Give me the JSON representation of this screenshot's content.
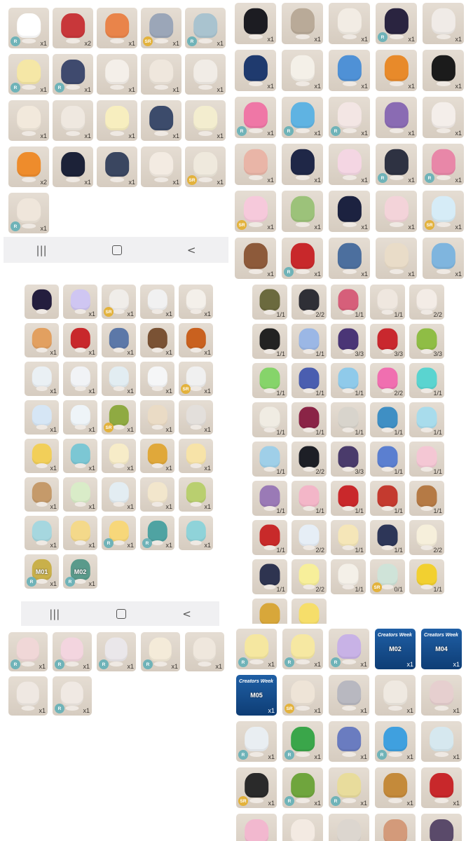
{
  "navbar": {
    "recent_icon": "|||",
    "back_icon": "<"
  },
  "panel_a": [
    {
      "n": "x1",
      "r": "R",
      "c": "#ffffff"
    },
    {
      "n": "x2",
      "r": "",
      "c": "#c8373a"
    },
    {
      "n": "x1",
      "r": "",
      "c": "#e9844a"
    },
    {
      "n": "x1",
      "r": "SR",
      "c": "#9ba6b8"
    },
    {
      "n": "x1",
      "r": "R",
      "c": "#a9c3cf"
    },
    {
      "n": "x1",
      "r": "R",
      "c": "#f5e7a6"
    },
    {
      "n": "x1",
      "r": "R",
      "c": "#3f4a6e"
    },
    {
      "n": "x1",
      "r": "",
      "c": "#f4efe9"
    },
    {
      "n": "x1",
      "r": "",
      "c": "#efe7dd"
    },
    {
      "n": "x1",
      "r": "",
      "c": "#f1ece6"
    },
    {
      "n": "x1",
      "r": "",
      "c": "#f2e9dc"
    },
    {
      "n": "x1",
      "r": "",
      "c": "#efe8e0"
    },
    {
      "n": "x1",
      "r": "",
      "c": "#f7eebf"
    },
    {
      "n": "x1",
      "r": "",
      "c": "#3c4b6b"
    },
    {
      "n": "x1",
      "r": "",
      "c": "#f3edcf"
    },
    {
      "n": "x2",
      "r": "",
      "c": "#ee8c2c"
    },
    {
      "n": "x1",
      "r": "",
      "c": "#1c2238"
    },
    {
      "n": "x1",
      "r": "",
      "c": "#3a4660"
    },
    {
      "n": "x1",
      "r": "",
      "c": "#f3ebe2"
    },
    {
      "n": "x1",
      "r": "SR",
      "c": "#efe9dd"
    },
    {
      "n": "x1",
      "r": "R",
      "c": "#efe6db"
    }
  ],
  "panel_b": [
    {
      "n": "x1",
      "r": "",
      "c": "#1c1c22"
    },
    {
      "n": "x1",
      "r": "",
      "c": "#b9aa98"
    },
    {
      "n": "x1",
      "r": "",
      "c": "#f2ece4"
    },
    {
      "n": "x1",
      "r": "R",
      "c": "#2a2440"
    },
    {
      "n": "x1",
      "r": "",
      "c": "#f0ebe7"
    },
    {
      "n": "x1",
      "r": "",
      "c": "#1f3a6e"
    },
    {
      "n": "x1",
      "r": "",
      "c": "#f4f0e8"
    },
    {
      "n": "x1",
      "r": "",
      "c": "#4f91d6"
    },
    {
      "n": "x1",
      "r": "",
      "c": "#e88a2a"
    },
    {
      "n": "x1",
      "r": "",
      "c": "#1b1b1b"
    },
    {
      "n": "x1",
      "r": "R",
      "c": "#ef77a6"
    },
    {
      "n": "x1",
      "r": "R",
      "c": "#5fb3e2"
    },
    {
      "n": "x1",
      "r": "R",
      "c": "#f3e6e4"
    },
    {
      "n": "x1",
      "r": "",
      "c": "#8a6bb3"
    },
    {
      "n": "x1",
      "r": "",
      "c": "#f4eeea"
    },
    {
      "n": "x1",
      "r": "",
      "c": "#e9b5a7"
    },
    {
      "n": "x1",
      "r": "",
      "c": "#1f2747"
    },
    {
      "n": "x1",
      "r": "",
      "c": "#f4d6e3"
    },
    {
      "n": "x1",
      "r": "R",
      "c": "#2e3242"
    },
    {
      "n": "x1",
      "r": "R",
      "c": "#e887a8"
    },
    {
      "n": "x1",
      "r": "SR",
      "c": "#f6c9db"
    },
    {
      "n": "x1",
      "r": "",
      "c": "#9cc27a"
    },
    {
      "n": "x1",
      "r": "",
      "c": "#1c2240"
    },
    {
      "n": "x1",
      "r": "",
      "c": "#f3d3d9"
    },
    {
      "n": "x1",
      "r": "SR",
      "c": "#d6ecf7"
    },
    {
      "n": "x1",
      "r": "",
      "c": "#8d5a3a"
    },
    {
      "n": "x1",
      "r": "R",
      "c": "#c8282b"
    },
    {
      "n": "x1",
      "r": "",
      "c": "#4c6f9e"
    },
    {
      "n": "x1",
      "r": "",
      "c": "#e9dcc8"
    },
    {
      "n": "x1",
      "r": "",
      "c": "#7fb5de"
    }
  ],
  "panel_c": [
    {
      "n": "",
      "r": "",
      "c": "#241e3e"
    },
    {
      "n": "x1",
      "r": "",
      "c": "#cfc6f2"
    },
    {
      "n": "x1",
      "r": "SR",
      "c": "#f0ede9"
    },
    {
      "n": "x1",
      "r": "",
      "c": "#f1f1f1"
    },
    {
      "n": "x1",
      "r": "",
      "c": "#f4f0ea"
    },
    {
      "n": "x1",
      "r": "",
      "c": "#e2a060"
    },
    {
      "n": "x1",
      "r": "",
      "c": "#c8282b"
    },
    {
      "n": "x1",
      "r": "",
      "c": "#5c78a8"
    },
    {
      "n": "x1",
      "r": "",
      "c": "#7a5234"
    },
    {
      "n": "x1",
      "r": "",
      "c": "#c9611f"
    },
    {
      "n": "x1",
      "r": "",
      "c": "#eaf0f4"
    },
    {
      "n": "x1",
      "r": "",
      "c": "#f1f3f6"
    },
    {
      "n": "x1",
      "r": "",
      "c": "#e2edf2"
    },
    {
      "n": "x1",
      "r": "",
      "c": "#f5f6f7"
    },
    {
      "n": "x1",
      "r": "SR",
      "c": "#f0f0f0"
    },
    {
      "n": "x1",
      "r": "",
      "c": "#d6e6f5"
    },
    {
      "n": "x1",
      "r": "",
      "c": "#eef4f8"
    },
    {
      "n": "x1",
      "r": "SR",
      "c": "#8faa42"
    },
    {
      "n": "x1",
      "r": "",
      "c": "#eadbc5"
    },
    {
      "n": "x1",
      "r": "",
      "c": "#e3dfdb"
    },
    {
      "n": "x1",
      "r": "",
      "c": "#f2cf59"
    },
    {
      "n": "x1",
      "r": "",
      "c": "#7cc7d4"
    },
    {
      "n": "x1",
      "r": "",
      "c": "#f7ecc8"
    },
    {
      "n": "x1",
      "r": "",
      "c": "#e0a83a"
    },
    {
      "n": "x1",
      "r": "",
      "c": "#f7e3a8"
    },
    {
      "n": "x1",
      "r": "",
      "c": "#c59a6a"
    },
    {
      "n": "x1",
      "r": "",
      "c": "#d9ecc8"
    },
    {
      "n": "x1",
      "r": "",
      "c": "#e3edf2"
    },
    {
      "n": "x1",
      "r": "",
      "c": "#f2e6cc"
    },
    {
      "n": "x1",
      "r": "",
      "c": "#b9cf6f"
    },
    {
      "n": "x1",
      "r": "",
      "c": "#a6d7df"
    },
    {
      "n": "x1",
      "r": "",
      "c": "#f4d98a"
    },
    {
      "n": "x1",
      "r": "R",
      "c": "#f7d77a"
    },
    {
      "n": "x1",
      "r": "R",
      "c": "#4fa3a2"
    },
    {
      "n": "x1",
      "r": "",
      "c": "#8fd3d9"
    },
    {
      "n": "x1",
      "r": "R",
      "c": "#c9b04a",
      "label": "M01"
    },
    {
      "n": "x1",
      "r": "R",
      "c": "#5a9a8b",
      "label": "M02"
    }
  ],
  "panel_d": [
    {
      "n": "1/1",
      "r": "",
      "c": "#6b6a3e"
    },
    {
      "n": "2/2",
      "r": "",
      "c": "#2f2f36"
    },
    {
      "n": "1/1",
      "r": "",
      "c": "#d65f7a"
    },
    {
      "n": "1/1",
      "r": "",
      "c": "#efe7df"
    },
    {
      "n": "2/2",
      "r": "",
      "c": "#f3ece6"
    },
    {
      "n": "1/1",
      "r": "",
      "c": "#222222"
    },
    {
      "n": "1/1",
      "r": "",
      "c": "#9bb7e5"
    },
    {
      "n": "3/3",
      "r": "",
      "c": "#4a3576"
    },
    {
      "n": "3/3",
      "r": "",
      "c": "#c9282e"
    },
    {
      "n": "3/3",
      "r": "",
      "c": "#8fbd45"
    },
    {
      "n": "1/1",
      "r": "",
      "c": "#86d46a"
    },
    {
      "n": "1/1",
      "r": "",
      "c": "#4a5eb0"
    },
    {
      "n": "1/1",
      "r": "",
      "c": "#8fcaea"
    },
    {
      "n": "2/2",
      "r": "",
      "c": "#f06fb0"
    },
    {
      "n": "1/1",
      "r": "",
      "c": "#5ad4d0"
    },
    {
      "n": "1/1",
      "r": "",
      "c": "#f0ece3"
    },
    {
      "n": "1/1",
      "r": "",
      "c": "#8a2446"
    },
    {
      "n": "1/1",
      "r": "",
      "c": "#d8d4cc"
    },
    {
      "n": "1/1",
      "r": "",
      "c": "#3f8fc4"
    },
    {
      "n": "1/1",
      "r": "",
      "c": "#a8dcec"
    },
    {
      "n": "1/1",
      "r": "",
      "c": "#9fcfe8"
    },
    {
      "n": "2/2",
      "r": "",
      "c": "#1d1f26"
    },
    {
      "n": "3/3",
      "r": "",
      "c": "#4a3b6b"
    },
    {
      "n": "1/1",
      "r": "",
      "c": "#5b7fd0"
    },
    {
      "n": "1/1",
      "r": "",
      "c": "#f4c7d4"
    },
    {
      "n": "1/1",
      "r": "",
      "c": "#9a7ab6"
    },
    {
      "n": "1/1",
      "r": "",
      "c": "#f3b6c8"
    },
    {
      "n": "1/1",
      "r": "",
      "c": "#c9282b"
    },
    {
      "n": "1/1",
      "r": "",
      "c": "#c43a2f"
    },
    {
      "n": "1/1",
      "r": "",
      "c": "#b57a45"
    },
    {
      "n": "1/1",
      "r": "",
      "c": "#c82a2a"
    },
    {
      "n": "2/2",
      "r": "",
      "c": "#e6eef6"
    },
    {
      "n": "1/1",
      "r": "",
      "c": "#f5e6b8"
    },
    {
      "n": "1/1",
      "r": "",
      "c": "#2d3658"
    },
    {
      "n": "2/2",
      "r": "",
      "c": "#f6efdb"
    },
    {
      "n": "1/1",
      "r": "",
      "c": "#2e3450"
    },
    {
      "n": "2/2",
      "r": "",
      "c": "#f7ef9a"
    },
    {
      "n": "1/1",
      "r": "",
      "c": "#f4f0e8"
    },
    {
      "n": "0/1",
      "r": "SR",
      "c": "#cfe3d8"
    },
    {
      "n": "1/1",
      "r": "",
      "c": "#f2d030"
    },
    {
      "n": "",
      "r": "",
      "c": "#d8a73a"
    },
    {
      "n": "",
      "r": "",
      "c": "#f6de6a"
    }
  ],
  "panel_e": [
    {
      "n": "x1",
      "r": "R",
      "c": "#f0d7d7"
    },
    {
      "n": "x1",
      "r": "R",
      "c": "#f3d5df"
    },
    {
      "n": "x1",
      "r": "R",
      "c": "#eae7ea"
    },
    {
      "n": "x1",
      "r": "R",
      "c": "#f4ebd9"
    },
    {
      "n": "x1",
      "r": "",
      "c": "#efe7dd"
    },
    {
      "n": "x1",
      "r": "",
      "c": "#efe8e2"
    },
    {
      "n": "x1",
      "r": "R",
      "c": "#f0e9e3"
    }
  ],
  "panel_f": [
    {
      "n": "x1",
      "r": "R",
      "c": "#f5e7a0"
    },
    {
      "n": "x1",
      "r": "R",
      "c": "#f6e8a2"
    },
    {
      "n": "x1",
      "r": "R",
      "c": "#c8b2e6"
    },
    {
      "n": "x1",
      "r": "",
      "c": "#1f5fa5",
      "label": "M02",
      "blue": true
    },
    {
      "n": "x1",
      "r": "",
      "c": "#1f5fa5",
      "label": "M04",
      "blue": true
    },
    {
      "n": "x1",
      "r": "",
      "c": "#1f5fa5",
      "label": "M05",
      "blue": true
    },
    {
      "n": "x1",
      "r": "SR",
      "c": "#eee4d7"
    },
    {
      "n": "x1",
      "r": "",
      "c": "#b8b8c0"
    },
    {
      "n": "x1",
      "r": "",
      "c": "#efe9e1"
    },
    {
      "n": "x1",
      "r": "",
      "c": "#e6cfcf"
    },
    {
      "n": "x1",
      "r": "R",
      "c": "#e9eef2"
    },
    {
      "n": "x1",
      "r": "R",
      "c": "#3aa64a"
    },
    {
      "n": "x1",
      "r": "",
      "c": "#6a7cc0"
    },
    {
      "n": "x1",
      "r": "R",
      "c": "#3fa0df"
    },
    {
      "n": "x1",
      "r": "",
      "c": "#d6e8ef"
    },
    {
      "n": "x1",
      "r": "SR",
      "c": "#2a2a2a"
    },
    {
      "n": "x1",
      "r": "R",
      "c": "#6fa53d"
    },
    {
      "n": "x1",
      "r": "R",
      "c": "#e8dc9c"
    },
    {
      "n": "x1",
      "r": "",
      "c": "#c48a3a"
    },
    {
      "n": "x1",
      "r": "",
      "c": "#c8282b"
    },
    {
      "n": "",
      "r": "",
      "c": "#f2b8cf"
    },
    {
      "n": "",
      "r": "",
      "c": "#f3eae2"
    },
    {
      "n": "",
      "r": "",
      "c": "#dcd6cf"
    },
    {
      "n": "",
      "r": "",
      "c": "#d39a7a"
    },
    {
      "n": "",
      "r": "",
      "c": "#5a4a6a"
    }
  ],
  "creators_label": "Creators Week"
}
